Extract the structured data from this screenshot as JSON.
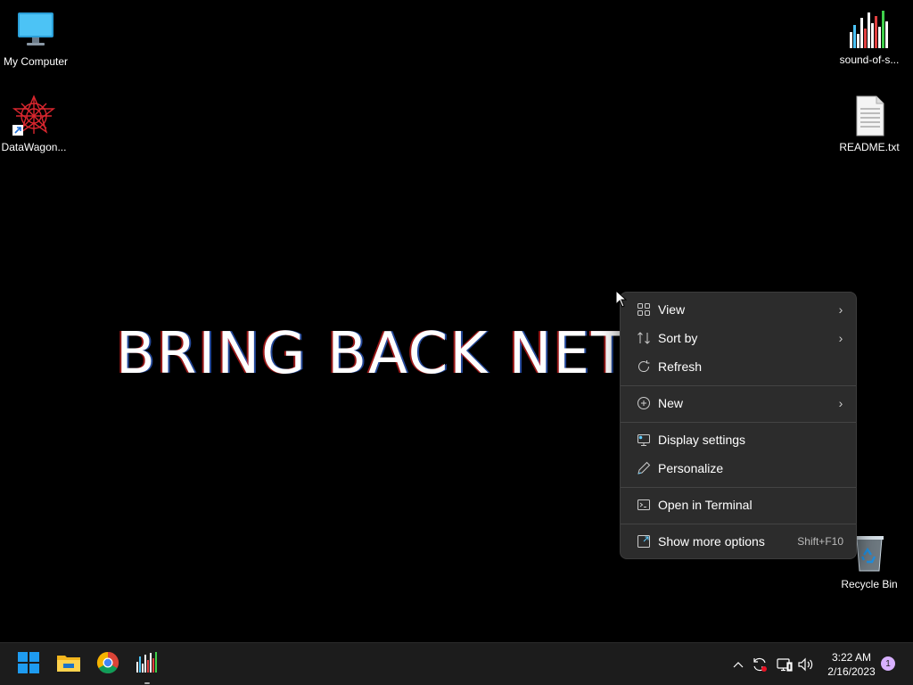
{
  "desktop": {
    "icons": {
      "my_computer": {
        "label": "My Computer",
        "icon": "monitor-icon"
      },
      "datawagon": {
        "label": "DataWagon...",
        "icon": "datawagon-shortcut-icon"
      },
      "sound": {
        "label": "sound-of-s...",
        "icon": "equalizer-app-icon"
      },
      "readme": {
        "label": "README.txt",
        "icon": "text-file-icon"
      },
      "recycle": {
        "label": "Recycle Bin",
        "icon": "recycle-bin-icon"
      }
    },
    "wallpaper_text": "BRING BACK NETV"
  },
  "context_menu": {
    "items": [
      {
        "label": "View",
        "icon": "grid-view-icon",
        "submenu": true
      },
      {
        "label": "Sort by",
        "icon": "sort-icon",
        "submenu": true
      },
      {
        "label": "Refresh",
        "icon": "refresh-icon",
        "submenu": false
      },
      {
        "label": "New",
        "icon": "plus-circle-icon",
        "submenu": true
      },
      {
        "label": "Display settings",
        "icon": "display-settings-icon",
        "submenu": false
      },
      {
        "label": "Personalize",
        "icon": "pen-icon",
        "submenu": false
      },
      {
        "label": "Open in Terminal",
        "icon": "terminal-icon",
        "submenu": false
      },
      {
        "label": "Show more options",
        "icon": "external-options-icon",
        "shortcut": "Shift+F10"
      }
    ]
  },
  "taskbar": {
    "pinned": [
      "windows-start-icon",
      "file-explorer-icon",
      "chrome-icon",
      "equalizer-app-icon"
    ],
    "tray": [
      "chevron-up-icon",
      "sync-icon",
      "network-icon",
      "volume-icon"
    ],
    "clock": {
      "time": "3:22 AM",
      "date": "2/16/2023"
    },
    "notification_count": "1"
  },
  "colors": {
    "menu_bg": "#2c2c2c",
    "taskbar_bg": "#1c1c1c",
    "accent": "#60cdff"
  }
}
